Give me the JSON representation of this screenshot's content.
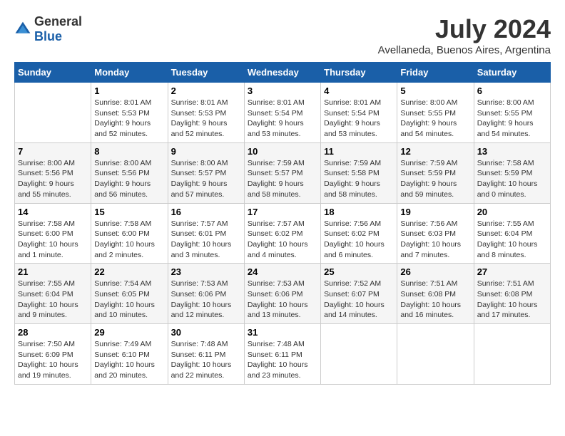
{
  "logo": {
    "general": "General",
    "blue": "Blue"
  },
  "header": {
    "month_year": "July 2024",
    "location": "Avellaneda, Buenos Aires, Argentina"
  },
  "days_of_week": [
    "Sunday",
    "Monday",
    "Tuesday",
    "Wednesday",
    "Thursday",
    "Friday",
    "Saturday"
  ],
  "weeks": [
    [
      {
        "day": "",
        "info": ""
      },
      {
        "day": "1",
        "info": "Sunrise: 8:01 AM\nSunset: 5:53 PM\nDaylight: 9 hours\nand 52 minutes."
      },
      {
        "day": "2",
        "info": "Sunrise: 8:01 AM\nSunset: 5:53 PM\nDaylight: 9 hours\nand 52 minutes."
      },
      {
        "day": "3",
        "info": "Sunrise: 8:01 AM\nSunset: 5:54 PM\nDaylight: 9 hours\nand 53 minutes."
      },
      {
        "day": "4",
        "info": "Sunrise: 8:01 AM\nSunset: 5:54 PM\nDaylight: 9 hours\nand 53 minutes."
      },
      {
        "day": "5",
        "info": "Sunrise: 8:00 AM\nSunset: 5:55 PM\nDaylight: 9 hours\nand 54 minutes."
      },
      {
        "day": "6",
        "info": "Sunrise: 8:00 AM\nSunset: 5:55 PM\nDaylight: 9 hours\nand 54 minutes."
      }
    ],
    [
      {
        "day": "7",
        "info": "Sunrise: 8:00 AM\nSunset: 5:56 PM\nDaylight: 9 hours\nand 55 minutes."
      },
      {
        "day": "8",
        "info": "Sunrise: 8:00 AM\nSunset: 5:56 PM\nDaylight: 9 hours\nand 56 minutes."
      },
      {
        "day": "9",
        "info": "Sunrise: 8:00 AM\nSunset: 5:57 PM\nDaylight: 9 hours\nand 57 minutes."
      },
      {
        "day": "10",
        "info": "Sunrise: 7:59 AM\nSunset: 5:57 PM\nDaylight: 9 hours\nand 58 minutes."
      },
      {
        "day": "11",
        "info": "Sunrise: 7:59 AM\nSunset: 5:58 PM\nDaylight: 9 hours\nand 58 minutes."
      },
      {
        "day": "12",
        "info": "Sunrise: 7:59 AM\nSunset: 5:59 PM\nDaylight: 9 hours\nand 59 minutes."
      },
      {
        "day": "13",
        "info": "Sunrise: 7:58 AM\nSunset: 5:59 PM\nDaylight: 10 hours\nand 0 minutes."
      }
    ],
    [
      {
        "day": "14",
        "info": "Sunrise: 7:58 AM\nSunset: 6:00 PM\nDaylight: 10 hours\nand 1 minute."
      },
      {
        "day": "15",
        "info": "Sunrise: 7:58 AM\nSunset: 6:00 PM\nDaylight: 10 hours\nand 2 minutes."
      },
      {
        "day": "16",
        "info": "Sunrise: 7:57 AM\nSunset: 6:01 PM\nDaylight: 10 hours\nand 3 minutes."
      },
      {
        "day": "17",
        "info": "Sunrise: 7:57 AM\nSunset: 6:02 PM\nDaylight: 10 hours\nand 4 minutes."
      },
      {
        "day": "18",
        "info": "Sunrise: 7:56 AM\nSunset: 6:02 PM\nDaylight: 10 hours\nand 6 minutes."
      },
      {
        "day": "19",
        "info": "Sunrise: 7:56 AM\nSunset: 6:03 PM\nDaylight: 10 hours\nand 7 minutes."
      },
      {
        "day": "20",
        "info": "Sunrise: 7:55 AM\nSunset: 6:04 PM\nDaylight: 10 hours\nand 8 minutes."
      }
    ],
    [
      {
        "day": "21",
        "info": "Sunrise: 7:55 AM\nSunset: 6:04 PM\nDaylight: 10 hours\nand 9 minutes."
      },
      {
        "day": "22",
        "info": "Sunrise: 7:54 AM\nSunset: 6:05 PM\nDaylight: 10 hours\nand 10 minutes."
      },
      {
        "day": "23",
        "info": "Sunrise: 7:53 AM\nSunset: 6:06 PM\nDaylight: 10 hours\nand 12 minutes."
      },
      {
        "day": "24",
        "info": "Sunrise: 7:53 AM\nSunset: 6:06 PM\nDaylight: 10 hours\nand 13 minutes."
      },
      {
        "day": "25",
        "info": "Sunrise: 7:52 AM\nSunset: 6:07 PM\nDaylight: 10 hours\nand 14 minutes."
      },
      {
        "day": "26",
        "info": "Sunrise: 7:51 AM\nSunset: 6:08 PM\nDaylight: 10 hours\nand 16 minutes."
      },
      {
        "day": "27",
        "info": "Sunrise: 7:51 AM\nSunset: 6:08 PM\nDaylight: 10 hours\nand 17 minutes."
      }
    ],
    [
      {
        "day": "28",
        "info": "Sunrise: 7:50 AM\nSunset: 6:09 PM\nDaylight: 10 hours\nand 19 minutes."
      },
      {
        "day": "29",
        "info": "Sunrise: 7:49 AM\nSunset: 6:10 PM\nDaylight: 10 hours\nand 20 minutes."
      },
      {
        "day": "30",
        "info": "Sunrise: 7:48 AM\nSunset: 6:11 PM\nDaylight: 10 hours\nand 22 minutes."
      },
      {
        "day": "31",
        "info": "Sunrise: 7:48 AM\nSunset: 6:11 PM\nDaylight: 10 hours\nand 23 minutes."
      },
      {
        "day": "",
        "info": ""
      },
      {
        "day": "",
        "info": ""
      },
      {
        "day": "",
        "info": ""
      }
    ]
  ]
}
